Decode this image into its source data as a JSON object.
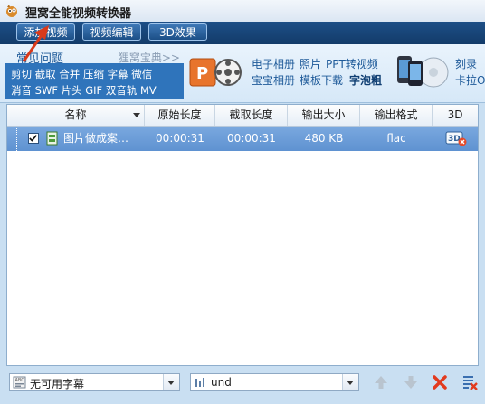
{
  "window": {
    "title": "狸窝全能视频转换器"
  },
  "toolbar": {
    "add_video": "添加视频",
    "edit_video": "视频编辑",
    "effect_3d": "3D效果"
  },
  "promo": {
    "faq_title": "常见问题",
    "faq_more": "狸窝宝典>>",
    "faq_row1": "剪切 截取 合并 压缩 字幕 微信",
    "faq_row2": "消音 SWF 片头 GIF 双音轨 MV",
    "album": "电子相册",
    "photo": "照片",
    "ppt_video": "PPT转视频",
    "baby_album": "宝宝相册",
    "template_download": "模板下载",
    "xiaopaoniu": "字泡粗",
    "burn": "刻录",
    "karaoke": "卡拉OK"
  },
  "table": {
    "columns": [
      "名称",
      "原始长度",
      "截取长度",
      "输出大小",
      "输出格式",
      "3D"
    ],
    "rows": [
      {
        "name": "图片做成案…",
        "original_length": "00:00:31",
        "cut_length": "00:00:31",
        "output_size": "480 KB",
        "output_format": "flac"
      }
    ]
  },
  "bottom": {
    "subtitle": "无可用字幕",
    "audio": "und"
  },
  "colors": {
    "toolbar": "#1d4f87",
    "selection": "#6c9dd8",
    "accent_red": "#d93a1b"
  }
}
